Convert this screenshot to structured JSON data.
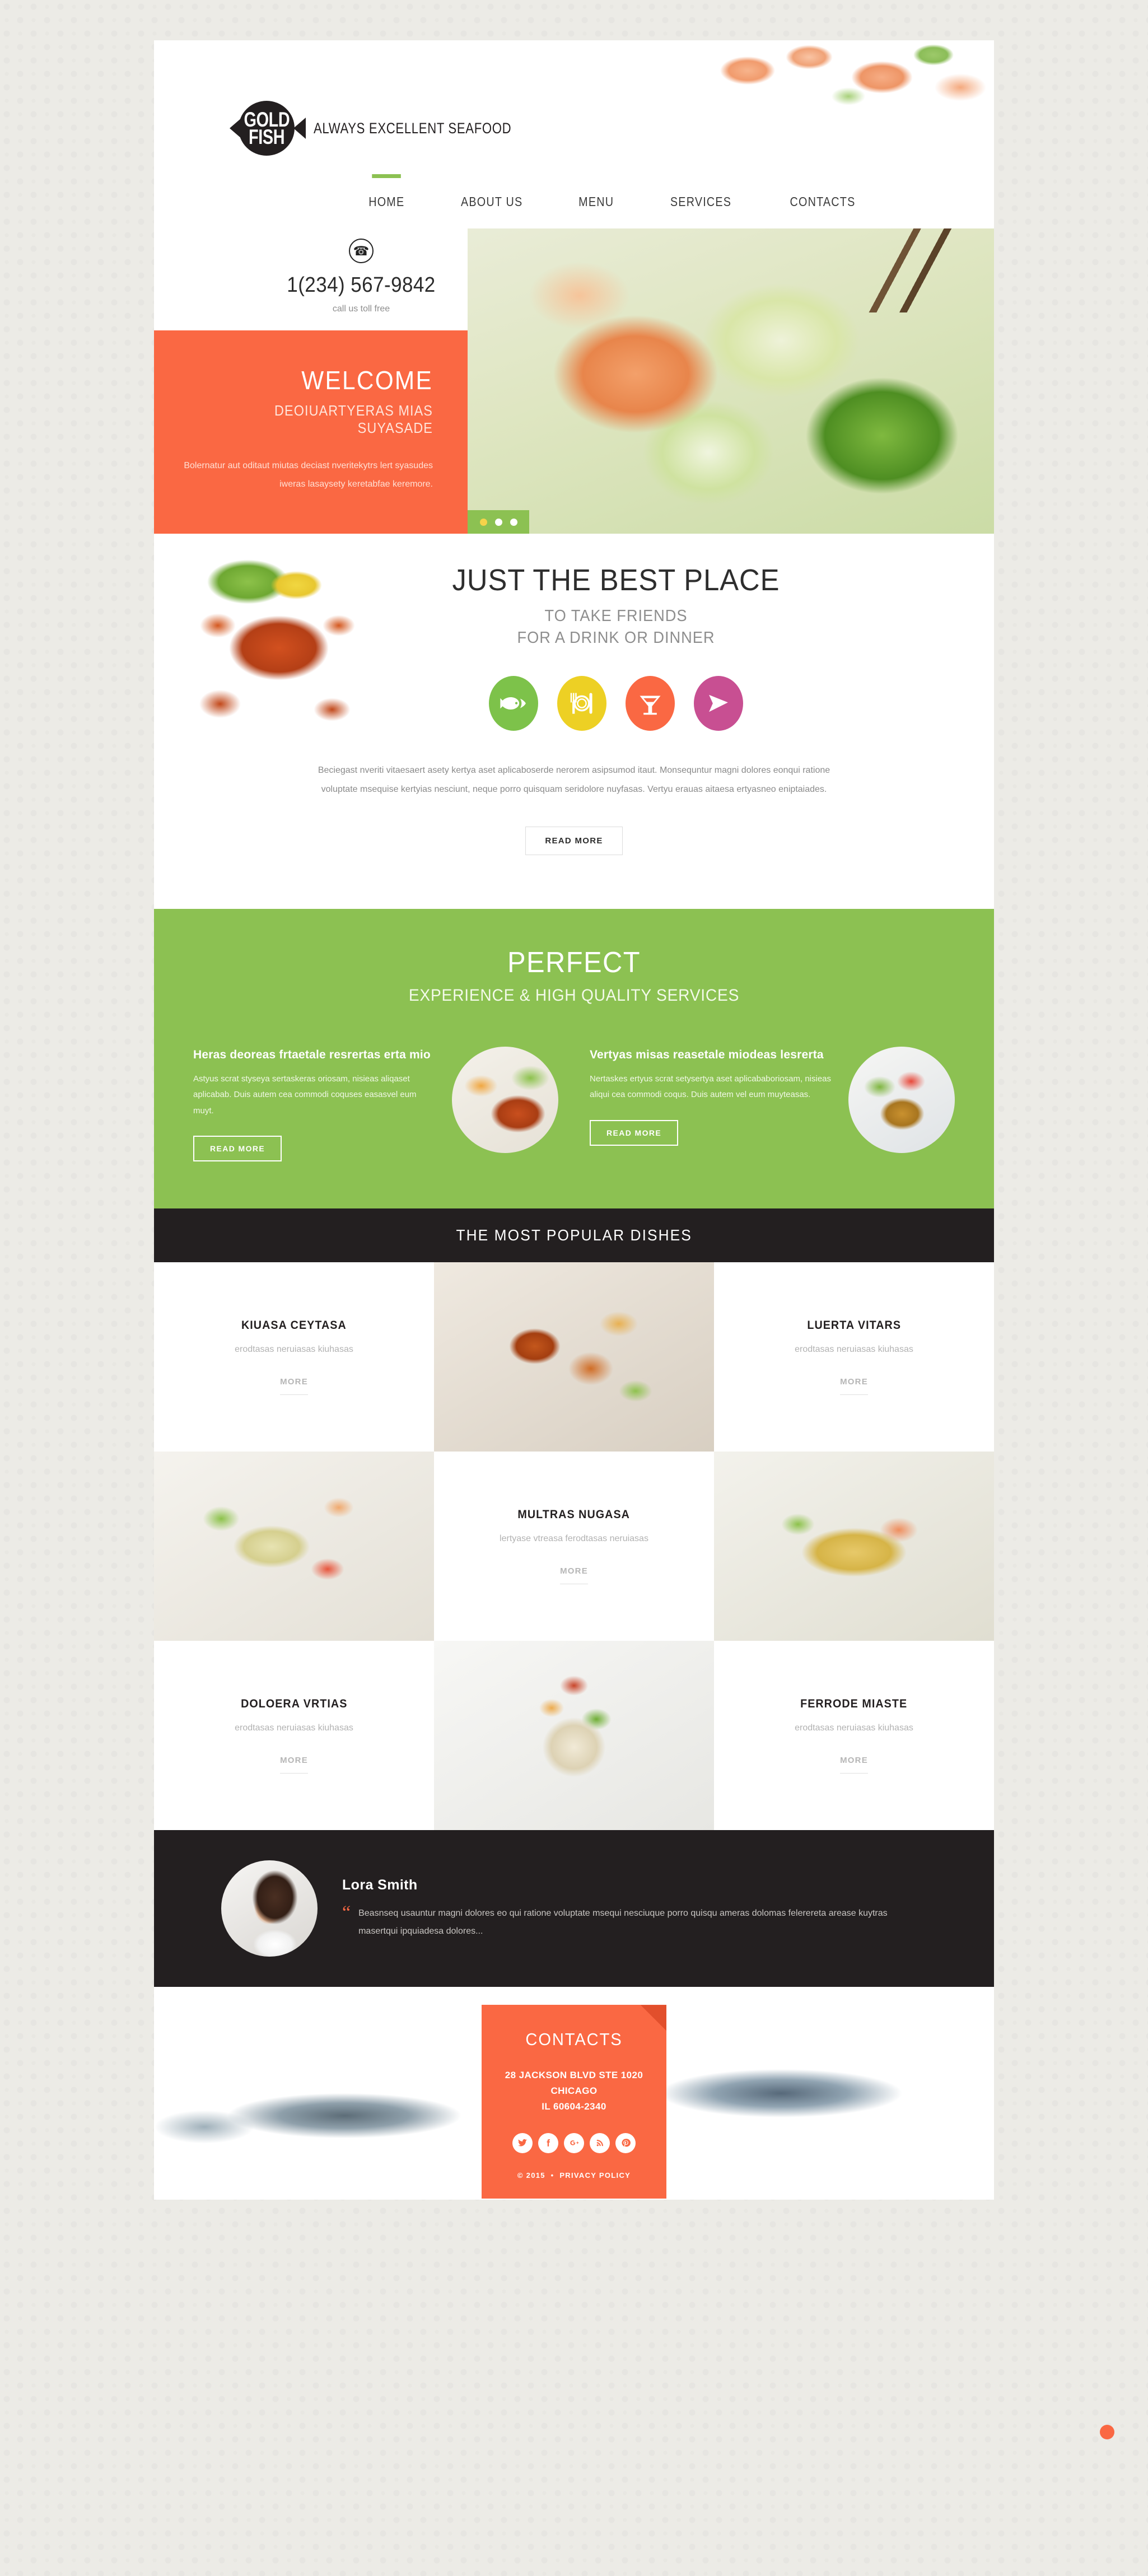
{
  "brand": {
    "logo_line1": "GOLD",
    "logo_line2": "FISH",
    "tagline": "ALWAYS EXCELLENT SEAFOOD"
  },
  "nav": {
    "items": [
      {
        "label": "HOME",
        "active": true
      },
      {
        "label": "ABOUT US",
        "active": false
      },
      {
        "label": "MENU",
        "active": false
      },
      {
        "label": "SERVICES",
        "active": false
      },
      {
        "label": "CONTACTS",
        "active": false
      }
    ]
  },
  "contact_top": {
    "icon": "phone-icon",
    "phone": "1(234) 567-9842",
    "note": "call us toll free"
  },
  "hero": {
    "welcome_title": "WELCOME",
    "welcome_subtitle": "DEOIUARTYERAS MIAS SUYASADE",
    "welcome_text": "Bolernatur aut oditaut miutas deciast nveritekytrs lert syasudes iweras lasaysety keretabfae keremore.",
    "slider_dots": 3,
    "active_dot": 1
  },
  "best": {
    "title": "JUST THE BEST PLACE",
    "subtitle_line1": "TO TAKE FRIENDS",
    "subtitle_line2": "FOR A DRINK OR DINNER",
    "icons": [
      {
        "name": "fish-icon",
        "color": "#7dc24a"
      },
      {
        "name": "plate-cutlery-icon",
        "color": "#edd024"
      },
      {
        "name": "cocktail-icon",
        "color": "#fa6843"
      },
      {
        "name": "fish-head-icon",
        "color": "#c84f92"
      }
    ],
    "paragraph": "Beciegast nveriti vitaesaert asety kertya aset aplicaboserde nerorem asipsumod itaut. Monsequntur magni dolores eonqui ratione voluptate msequise kertyias nesciunt, neque porro quisquam seridolore nuyfasas. Vertyu erauas aitaesa ertyasneo eniptaiades.",
    "button": "READ MORE"
  },
  "perfect": {
    "title": "PERFECT",
    "subtitle": "EXPERIENCE & HIGH QUALITY SERVICES",
    "services": [
      {
        "title": "Heras deoreas frtaetale resrertas erta mio",
        "text": "Astyus scrat styseya sertaskeras oriosam, nisieas aliqaset aplicabab. Duis autem cea commodi coquses easasvel eum muyt.",
        "button": "READ MORE"
      },
      {
        "title": "Vertyas misas reasetale miodeas lesrerta",
        "text": "Nertaskes ertyus scrat setysertya aset aplicababoriosam, nisieas aliqui cea commodi coqus. Duis autem vel eum muyteasas.",
        "button": "READ MORE"
      }
    ]
  },
  "dishes": {
    "heading": "THE MOST POPULAR DISHES",
    "items": [
      {
        "title": "KIUASA CEYTASA",
        "desc": "erodtasas neruiasas kiuhasas",
        "more": "MORE"
      },
      {
        "title": "LUERTA VITARS",
        "desc": "erodtasas neruiasas kiuhasas",
        "more": "MORE"
      },
      {
        "title": "MULTRAS NUGASA",
        "desc": "lertyase vtreasa ferodtasas neruiasas",
        "more": "MORE"
      },
      {
        "title": "DOLOERA VRTIAS",
        "desc": "erodtasas neruiasas kiuhasas",
        "more": "MORE"
      },
      {
        "title": "FERRODE MIASTE",
        "desc": "erodtasas neruiasas kiuhasas",
        "more": "MORE"
      }
    ]
  },
  "testimonial": {
    "name": "Lora Smith",
    "quote_mark": "“",
    "text": "Beasnseq usauntur magni dolores eo qui ratione voluptate msequi nesciuque porro quisqu ameras dolomas felerereta arease kuytras masertqui ipquiadesa dolores..."
  },
  "footer": {
    "title": "CONTACTS",
    "address_line1": "28 JACKSON BLVD STE 1020 CHICAGO",
    "address_line2": "IL 60604-2340",
    "socials": [
      {
        "name": "twitter-icon",
        "glyph": "t"
      },
      {
        "name": "facebook-icon",
        "glyph": "f"
      },
      {
        "name": "google-plus-icon",
        "glyph": "g+"
      },
      {
        "name": "rss-icon",
        "glyph": "r"
      },
      {
        "name": "pinterest-icon",
        "glyph": "p"
      }
    ],
    "copyright": "© 2015",
    "separator": "•",
    "privacy": "PRIVACY POLICY"
  },
  "colors": {
    "accent_orange": "#fa6843",
    "accent_green": "#8cc152",
    "dark": "#231f20"
  }
}
